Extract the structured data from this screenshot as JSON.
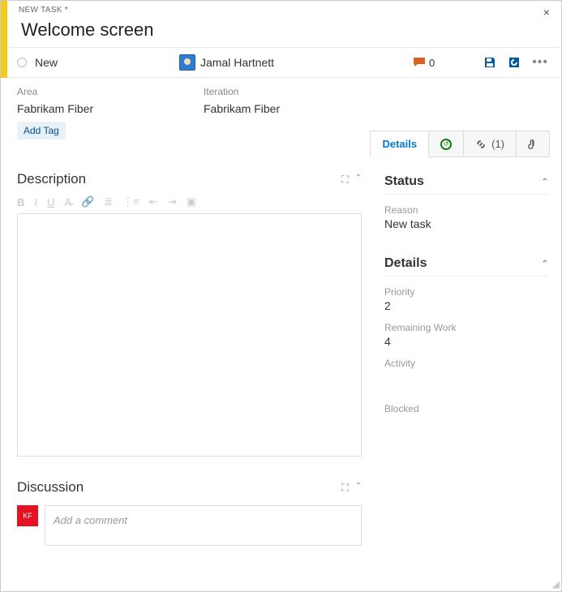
{
  "breadcrumb": "NEW TASK *",
  "title": "Welcome screen",
  "state": {
    "label": "New"
  },
  "assignee": {
    "name": "Jamal Hartnett"
  },
  "comments": {
    "count": "0"
  },
  "fields": {
    "area": {
      "label": "Area",
      "value": "Fabrikam Fiber"
    },
    "iteration": {
      "label": "Iteration",
      "value": "Fabrikam Fiber"
    }
  },
  "add_tag": "Add Tag",
  "tabs": {
    "details": "Details",
    "links": "(1)"
  },
  "sections": {
    "description": "Description",
    "discussion": "Discussion"
  },
  "discussion": {
    "avatar_initials": "KF",
    "placeholder": "Add a comment"
  },
  "side": {
    "status_title": "Status",
    "reason_label": "Reason",
    "reason_value": "New task",
    "details_title": "Details",
    "priority_label": "Priority",
    "priority_value": "2",
    "remaining_label": "Remaining Work",
    "remaining_value": "4",
    "activity_label": "Activity",
    "blocked_label": "Blocked"
  }
}
